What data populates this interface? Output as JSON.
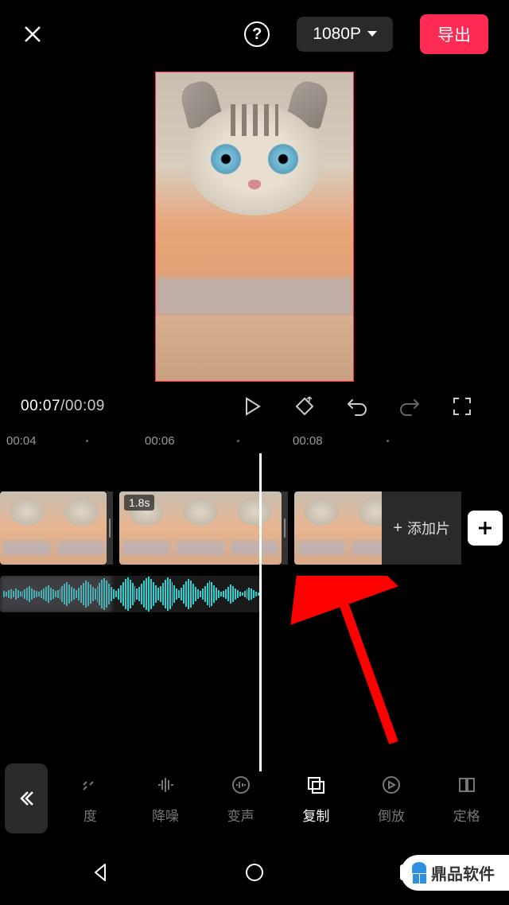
{
  "header": {
    "resolution": "1080P",
    "export": "导出"
  },
  "time": {
    "current": "00:07",
    "total": "00:09"
  },
  "ruler": {
    "t1": "00:04",
    "t2": "00:06",
    "t3": "00:08"
  },
  "clip": {
    "duration": "1.8s",
    "add": "添加片"
  },
  "tools": {
    "t1": "度",
    "t2": "降噪",
    "t3": "变声",
    "t4": "复制",
    "t5": "倒放",
    "t6": "定格"
  },
  "brand": "鼎品软件"
}
